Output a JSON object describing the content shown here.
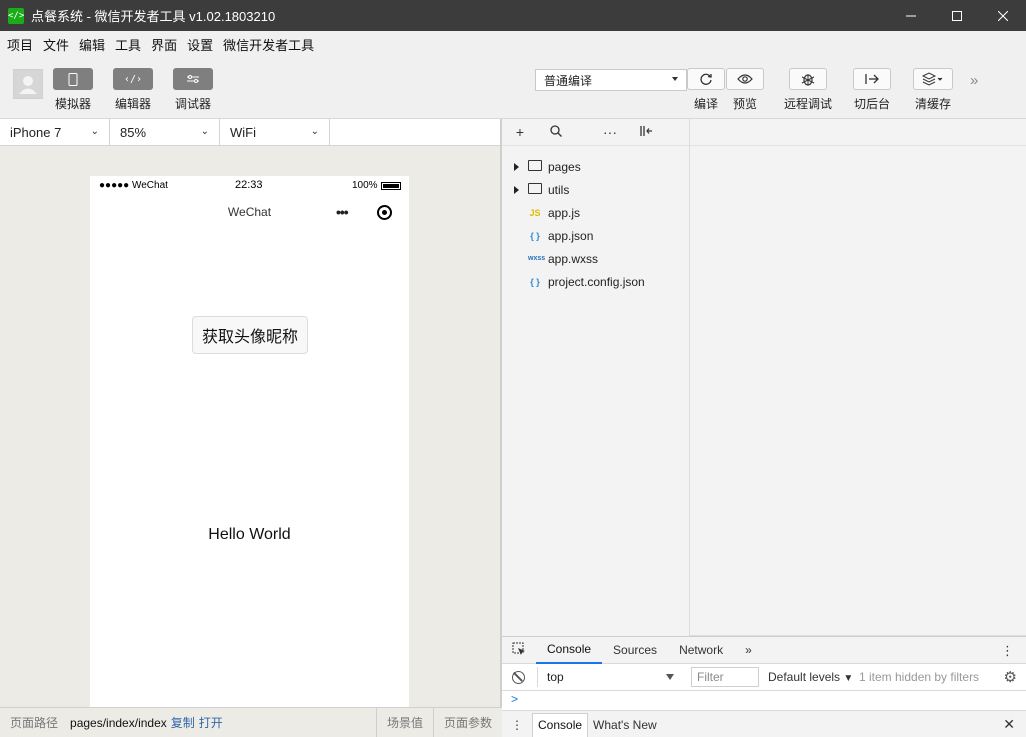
{
  "window": {
    "title": "点餐系统 - 微信开发者工具 v1.02.1803210",
    "logo_glyph": "</>"
  },
  "menu": [
    "项目",
    "文件",
    "编辑",
    "工具",
    "界面",
    "设置",
    "微信开发者工具"
  ],
  "toolbar": {
    "simulator_label": "模拟器",
    "editor_label": "编辑器",
    "debugger_label": "调试器",
    "compile_mode": "普通编译",
    "compile_label": "编译",
    "preview_label": "预览",
    "remote_debug_label": "远程调试",
    "background_label": "切后台",
    "clear_cache_label": "清缓存"
  },
  "simulator": {
    "device": "iPhone 7",
    "zoom": "85%",
    "network": "WiFi",
    "status_left": "●●●●● WeChat",
    "status_time": "22:33",
    "status_battery": "100%",
    "nav_title": "WeChat",
    "avatar_button": "获取头像昵称",
    "hello_text": "Hello World"
  },
  "pathbar": {
    "label": "页面路径",
    "value": "pages/index/index",
    "copy": "复制",
    "open": "打开",
    "scene": "场景值",
    "params": "页面参数"
  },
  "files": [
    {
      "name": "pages",
      "type": "folder"
    },
    {
      "name": "utils",
      "type": "folder"
    },
    {
      "name": "app.js",
      "type": "js",
      "icon": "JS"
    },
    {
      "name": "app.json",
      "type": "json",
      "icon": "{ }"
    },
    {
      "name": "app.wxss",
      "type": "wxss",
      "icon": "wxss"
    },
    {
      "name": "project.config.json",
      "type": "json",
      "icon": "{ }"
    }
  ],
  "devtools": {
    "tabs": [
      "Console",
      "Sources",
      "Network"
    ],
    "context": "top",
    "filter_placeholder": "Filter",
    "levels": "Default levels",
    "hidden_note": "1 item hidden by filters",
    "prompt": ">",
    "drawer_tabs": [
      "Console",
      "What's New"
    ]
  },
  "colors": {
    "titlebar": "#3c3c3c",
    "accent_blue": "#1a73e8",
    "link_blue": "#3366aa",
    "logo_green": "#1aad19"
  }
}
